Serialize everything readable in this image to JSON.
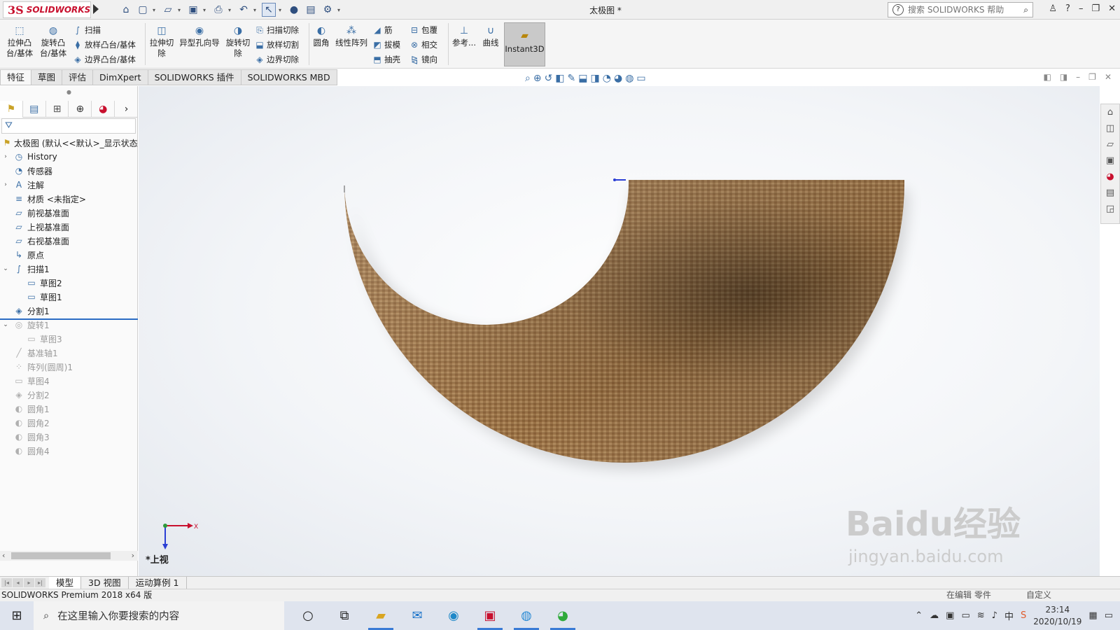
{
  "app": {
    "logo_ds": "3S",
    "logo_word": "SOLIDWORKS",
    "document_title": "太极图 *",
    "search_placeholder": "搜索 SOLIDWORKS 帮助"
  },
  "ribbon": {
    "extrude_boss": "拉伸凸\n台/基体",
    "revolve_boss": "旋转凸\n台/基体",
    "sweep": "扫描",
    "loft_boss": "放样凸台/基体",
    "boundary_boss": "边界凸台/基体",
    "extrude_cut": "拉伸切\n除",
    "hole_wizard": "异型孔向导",
    "revolve_cut": "旋转切\n除",
    "swept_cut": "扫描切除",
    "lofted_cut": "放样切割",
    "boundary_cut": "边界切除",
    "fillet": "圆角",
    "linear_pattern": "线性阵列",
    "rib": "筋",
    "draft": "拔模",
    "shell": "抽壳",
    "wrap": "包覆",
    "intersect": "相交",
    "mirror": "镜向",
    "reference": "参考...",
    "curves": "曲线",
    "instant3d": "Instant3D"
  },
  "tabs": [
    "特征",
    "草图",
    "评估",
    "DimXpert",
    "SOLIDWORKS 插件",
    "SOLIDWORKS MBD"
  ],
  "tree": {
    "root": "太极图 (默认<<默认>_显示状态",
    "items": [
      {
        "label": "History",
        "icon": "history-icon",
        "expand": "›",
        "indent": 0,
        "suppressed": false
      },
      {
        "label": "传感器",
        "icon": "sensor-icon",
        "expand": "",
        "indent": 0,
        "suppressed": false
      },
      {
        "label": "注解",
        "icon": "annotation-icon",
        "expand": "›",
        "indent": 0,
        "suppressed": false
      },
      {
        "label": "材质 <未指定>",
        "icon": "material-icon",
        "expand": "",
        "indent": 0,
        "suppressed": false
      },
      {
        "label": "前视基准面",
        "icon": "plane-icon",
        "expand": "",
        "indent": 0,
        "suppressed": false
      },
      {
        "label": "上视基准面",
        "icon": "plane-icon",
        "expand": "",
        "indent": 0,
        "suppressed": false
      },
      {
        "label": "右视基准面",
        "icon": "plane-icon",
        "expand": "",
        "indent": 0,
        "suppressed": false
      },
      {
        "label": "原点",
        "icon": "origin-icon",
        "expand": "",
        "indent": 0,
        "suppressed": false
      },
      {
        "label": "扫描1",
        "icon": "sweep-icon",
        "expand": "⌄",
        "indent": 0,
        "suppressed": false
      },
      {
        "label": "草图2",
        "icon": "sketch-icon",
        "expand": "",
        "indent": 1,
        "suppressed": false
      },
      {
        "label": "草图1",
        "icon": "sketch-icon",
        "expand": "",
        "indent": 1,
        "suppressed": false
      },
      {
        "label": "分割1",
        "icon": "split-icon",
        "expand": "",
        "indent": 0,
        "suppressed": false
      },
      {
        "label": "旋转1",
        "icon": "revolve-icon",
        "expand": "⌄",
        "indent": 0,
        "suppressed": true
      },
      {
        "label": "草图3",
        "icon": "sketch-icon",
        "expand": "",
        "indent": 1,
        "suppressed": true
      },
      {
        "label": "基准轴1",
        "icon": "axis-icon",
        "expand": "",
        "indent": 0,
        "suppressed": true
      },
      {
        "label": "阵列(圆周)1",
        "icon": "pattern-icon",
        "expand": "",
        "indent": 0,
        "suppressed": true
      },
      {
        "label": "草图4",
        "icon": "sketch-icon",
        "expand": "",
        "indent": 0,
        "suppressed": true
      },
      {
        "label": "分割2",
        "icon": "split-icon",
        "expand": "",
        "indent": 0,
        "suppressed": true
      },
      {
        "label": "圆角1",
        "icon": "fillet-icon",
        "expand": "",
        "indent": 0,
        "suppressed": true
      },
      {
        "label": "圆角2",
        "icon": "fillet-icon",
        "expand": "",
        "indent": 0,
        "suppressed": true
      },
      {
        "label": "圆角3",
        "icon": "fillet-icon",
        "expand": "",
        "indent": 0,
        "suppressed": true
      },
      {
        "label": "圆角4",
        "icon": "fillet-icon",
        "expand": "",
        "indent": 0,
        "suppressed": true
      }
    ]
  },
  "graphics": {
    "view_label": "*上视",
    "triad_x": "X",
    "watermark_logo": "Baidu经验",
    "watermark_url": "jingyan.baidu.com"
  },
  "model_tabs": [
    "模型",
    "3D 视图",
    "运动算例 1"
  ],
  "status": {
    "left": "SOLIDWORKS Premium 2018 x64 版",
    "mid": "在编辑 零件",
    "right": "自定义"
  },
  "taskbar": {
    "search_placeholder": "在这里输入你要搜索的内容",
    "time": "23:14",
    "date": "2020/10/19",
    "ime": "中"
  },
  "colors": {
    "accent": "#3a6ea5",
    "brand_red": "#c8102e",
    "texture_brown": "#9c7448",
    "rollback_bar": "#2b6cc4"
  }
}
